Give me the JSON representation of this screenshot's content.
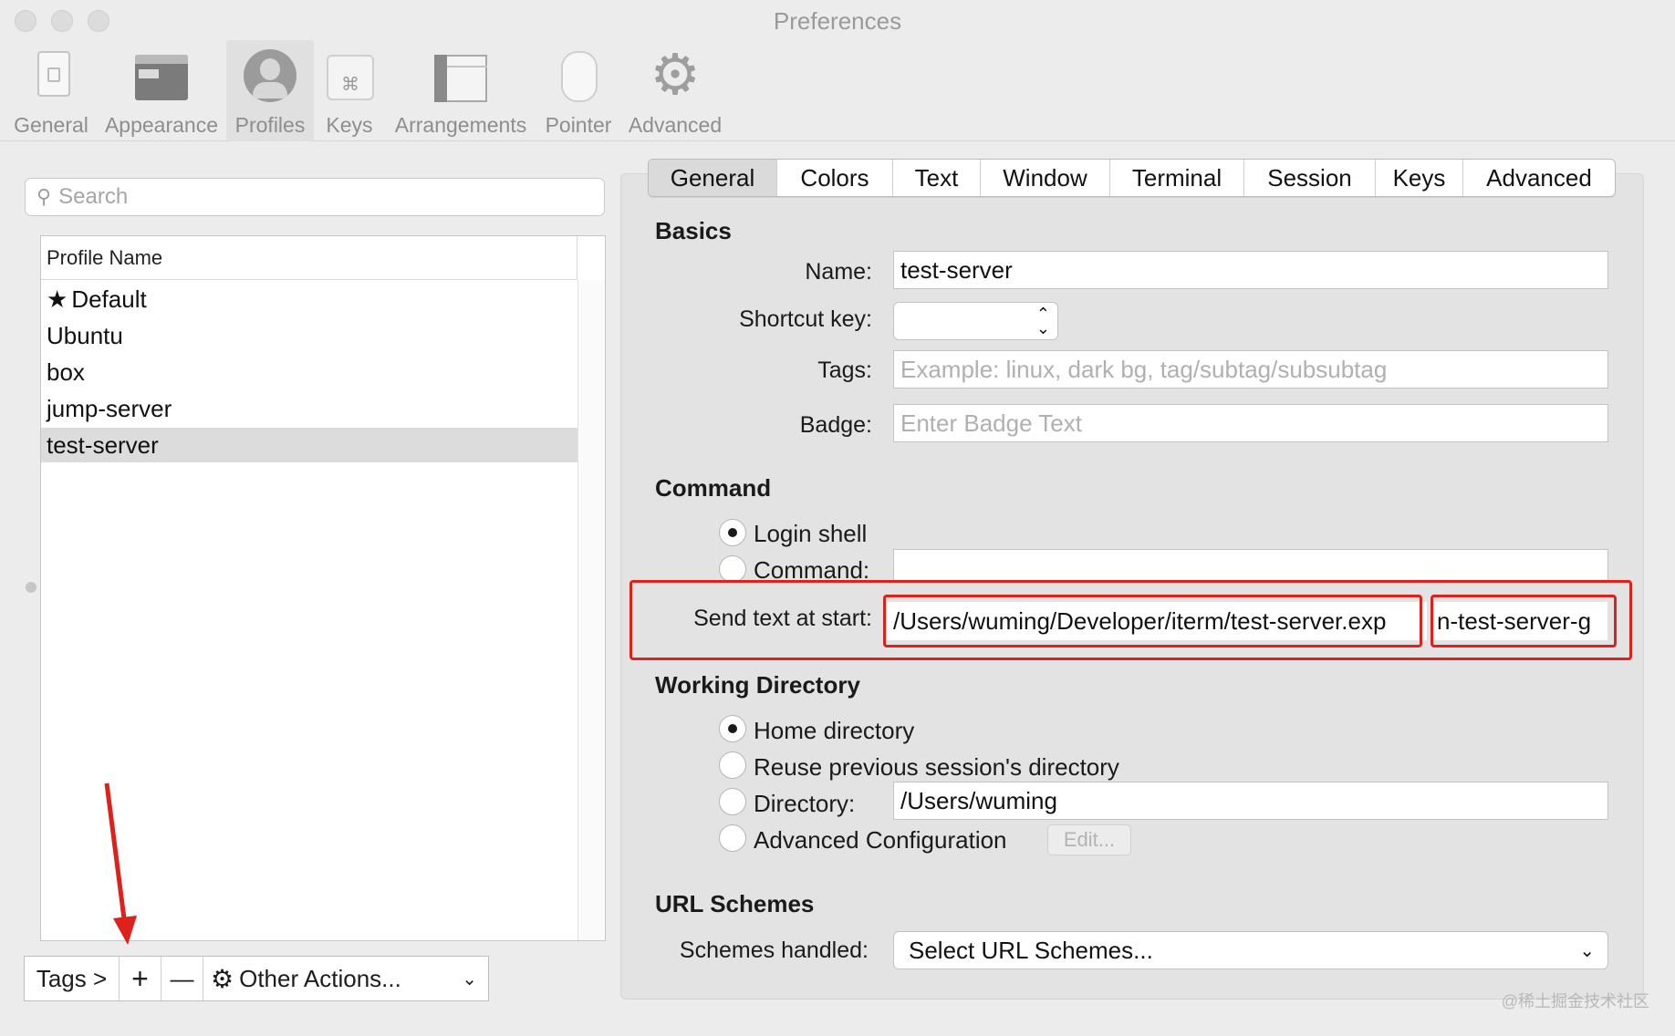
{
  "window": {
    "title": "Preferences"
  },
  "toolbar": {
    "items": [
      {
        "label": "General",
        "icon": "general-icon"
      },
      {
        "label": "Appearance",
        "icon": "appearance-icon"
      },
      {
        "label": "Profiles",
        "icon": "profiles-icon",
        "selected": true
      },
      {
        "label": "Keys",
        "icon": "keys-icon"
      },
      {
        "label": "Arrangements",
        "icon": "arrangements-icon"
      },
      {
        "label": "Pointer",
        "icon": "pointer-icon"
      },
      {
        "label": "Advanced",
        "icon": "gear-icon"
      }
    ]
  },
  "sidebar": {
    "search_placeholder": "Search",
    "column_header": "Profile Name",
    "profiles": [
      {
        "name": "Default",
        "default": true
      },
      {
        "name": "Ubuntu"
      },
      {
        "name": "box"
      },
      {
        "name": "jump-server"
      },
      {
        "name": "test-server",
        "selected": true
      }
    ],
    "bottom": {
      "tags": "Tags >",
      "add": "+",
      "remove": "—",
      "other_actions": "Other Actions..."
    }
  },
  "tabs": [
    "General",
    "Colors",
    "Text",
    "Window",
    "Terminal",
    "Session",
    "Keys",
    "Advanced"
  ],
  "general": {
    "basics_title": "Basics",
    "name_label": "Name:",
    "name_value": "test-server",
    "shortcut_label": "Shortcut key:",
    "tags_label": "Tags:",
    "tags_placeholder": "Example: linux, dark bg, tag/subtag/subsubtag",
    "badge_label": "Badge:",
    "badge_placeholder": "Enter Badge Text",
    "command_title": "Command",
    "login_shell": "Login shell",
    "command_label": "Command:",
    "send_text_label": "Send text at start:",
    "send_text_value": "/Users/wuming/Developer/iterm/test-server.exp",
    "send_text_tail": "n-test-server-g",
    "workdir_title": "Working Directory",
    "home_dir": "Home directory",
    "reuse_dir": "Reuse previous session's directory",
    "directory_label": "Directory:",
    "directory_value": "/Users/wuming",
    "advanced_config": "Advanced Configuration",
    "edit_button": "Edit...",
    "url_title": "URL Schemes",
    "schemes_label": "Schemes handled:",
    "schemes_value": "Select URL Schemes..."
  },
  "watermark": "@稀土掘金技术社区",
  "colors": {
    "highlight": "#e0201b",
    "selected_row": "#dcdcdc"
  }
}
